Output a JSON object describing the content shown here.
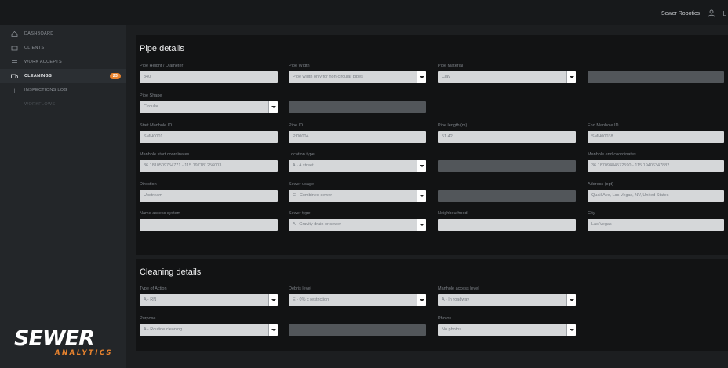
{
  "topbar": {
    "user_name": "Sewer Robotics",
    "logout": "L"
  },
  "sidebar": {
    "items": [
      {
        "label": "Dashboard",
        "icon": "home-icon"
      },
      {
        "label": "Clients",
        "icon": "clients-icon"
      },
      {
        "label": "Work Accepts",
        "icon": "list-icon"
      },
      {
        "label": "Cleanings",
        "icon": "truck-icon",
        "badge": "23"
      },
      {
        "label": "Inspections Log",
        "icon": "camera-icon"
      },
      {
        "label": "Workflows",
        "icon": ""
      }
    ],
    "logo": {
      "word1": "SEWER",
      "word2": "ANALYTICS"
    }
  },
  "pipe_details": {
    "title": "Pipe details",
    "fields": {
      "pipe_height": {
        "label": "Pipe Height / Diameter",
        "value": "340"
      },
      "pipe_width": {
        "label": "Pipe Width",
        "value": "Pipe width only for non-circular pipes",
        "dropdown": true
      },
      "pipe_material": {
        "label": "Pipe Material",
        "value": "Clay",
        "dropdown": true
      },
      "pipe_shape": {
        "label": "Pipe Shape",
        "value": "Circular",
        "dropdown": true
      },
      "start_manhole": {
        "label": "Start Manhole ID",
        "value": "SMH0001"
      },
      "pipe_id": {
        "label": "Pipe ID",
        "value": "PI00004"
      },
      "pipe_length": {
        "label": "Pipe length (m)",
        "value": "51.42"
      },
      "end_manhole": {
        "label": "End Manhole ID",
        "value": "SMH00038"
      },
      "start_coords": {
        "label": "Manhole start coordinates",
        "value": "36.1810509754771 - 115.197181256003"
      },
      "location_type": {
        "label": "Location type",
        "value": "A - A street",
        "dropdown": true
      },
      "end_coords": {
        "label": "Manhole end coordinates",
        "value": "36.18709484572590 - 115.19406347882"
      },
      "direction": {
        "label": "Direction",
        "value": "Upstream"
      },
      "sewer_usage": {
        "label": "Sewer usage",
        "value": "C - Combined sewer",
        "dropdown": true
      },
      "address": {
        "label": "Address (opt)",
        "value": "Quail Ave, Las Vegas, NV, United States"
      },
      "access_system": {
        "label": "Name access system",
        "value": ""
      },
      "sewer_type": {
        "label": "Sewer type",
        "value": "A - Gravity drain or sewer",
        "dropdown": true
      },
      "neighbourhood": {
        "label": "Neighbourhood",
        "value": ""
      },
      "city": {
        "label": "City",
        "value": "Las Vegas"
      }
    }
  },
  "cleaning_details": {
    "title": "Cleaning details",
    "fields": {
      "type_of_action": {
        "label": "Type of Action",
        "value": "A - RN",
        "dropdown": true
      },
      "debris_level": {
        "label": "Debris level",
        "value": "E - 0% x restriction",
        "dropdown": true
      },
      "manhole_access": {
        "label": "Manhole access level",
        "value": "A - In roadway",
        "dropdown": true
      },
      "purpose": {
        "label": "Purpose",
        "value": "A - Routine cleaning",
        "dropdown": true
      },
      "photos": {
        "label": "Photos",
        "value": "No photos",
        "dropdown": true
      }
    }
  },
  "colors": {
    "accent": "#e8832e",
    "panel": "#121314",
    "sidebar": "#232629",
    "field": "#d5d7d9"
  }
}
